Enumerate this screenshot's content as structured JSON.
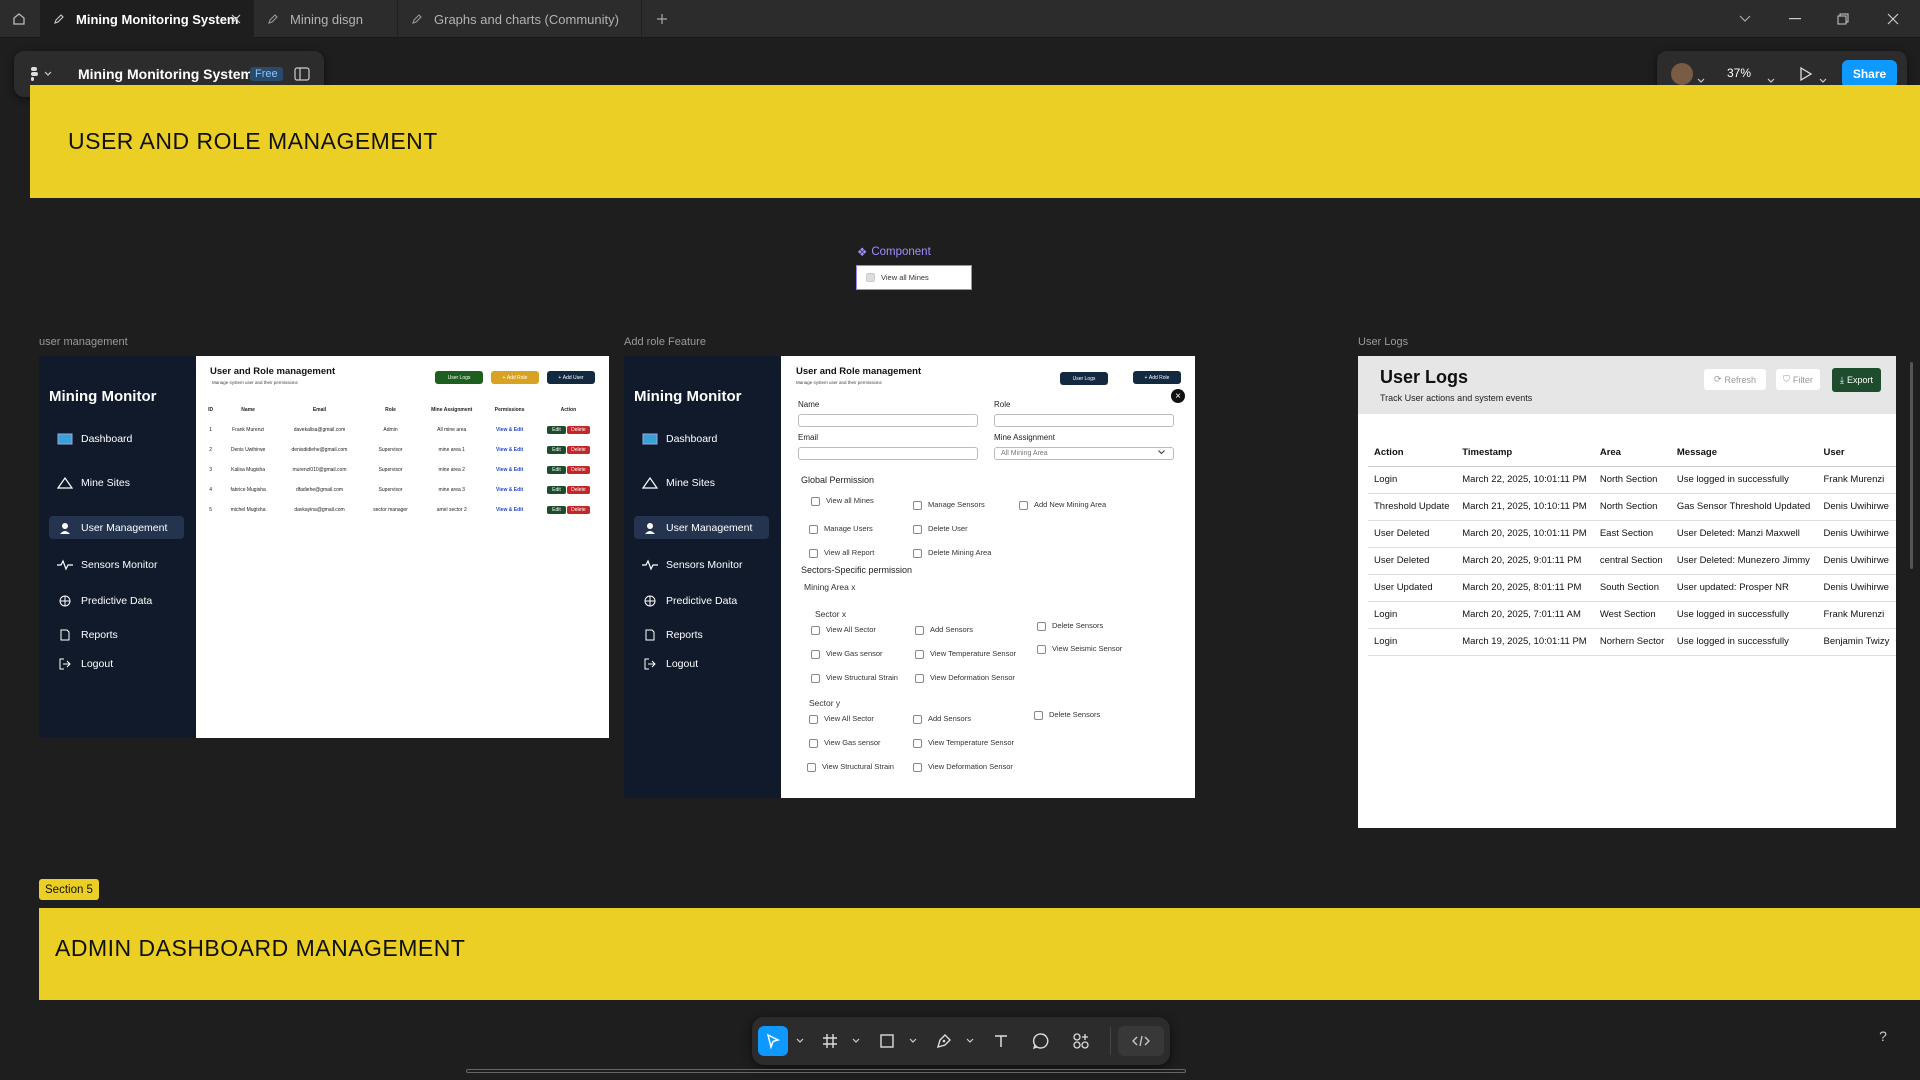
{
  "tabs": [
    {
      "label": "Mining Monitoring System",
      "active": true
    },
    {
      "label": "Mining disgn",
      "active": false
    },
    {
      "label": "Graphs and charts (Community)",
      "active": false
    }
  ],
  "file": {
    "title": "Mining Monitoring System",
    "plan": "Free"
  },
  "zoom": "37%",
  "share_label": "Share",
  "sections": {
    "top_title": "USER AND ROLE MANAGEMENT",
    "section_badge": "Section 5",
    "bottom_title": "ADMIN DASHBOARD MANAGEMENT"
  },
  "component": {
    "label": "Component",
    "item": "View all Mines"
  },
  "frame_labels": {
    "user_management": "user management",
    "add_role": "Add role Feature",
    "user_logs": "User Logs"
  },
  "sidebar": {
    "brand": "Mining  Monitor",
    "items": [
      "Dashboard",
      "Mine Sites",
      "User Management",
      "Sensors Monitor",
      "Predictive Data",
      "Reports",
      "Logout"
    ]
  },
  "user_mgmt": {
    "title": "User and Role management",
    "subtitle": "Manage system user and their permissions",
    "btn_logs": "User Logs",
    "btn_role": "Add Role",
    "btn_user": "Add User",
    "columns": [
      "ID",
      "Name",
      "Email",
      "Role",
      "Mine Assignment",
      "Permissions",
      "Action"
    ],
    "rows": [
      [
        "1",
        "Frank Murenzi",
        "davekalisa@gmail.com",
        "Admin",
        "All mine area",
        "View & Edit"
      ],
      [
        "2",
        "Denis Uwihirwe",
        "denisdidiehe@gmail.com",
        "Supervisor",
        "mine area 1",
        "View & Edit"
      ],
      [
        "3",
        "Kalisa Mugisha",
        "murenzi010@gmail.com",
        "Supervisor",
        "mine area 2",
        "View & Edit"
      ],
      [
        "4",
        "fabrice Mugisha",
        "dfadiehe@gmail.com",
        "Supervisor",
        "mine area 3",
        "View & Edit"
      ],
      [
        "5",
        "michel Mugisha",
        "davkayina@gmail.com",
        "sector manager",
        "amel sector 2",
        "View & Edit"
      ]
    ],
    "edit": "Edit",
    "delete": "Delete"
  },
  "add_role": {
    "title": "User and Role management",
    "subtitle": "Manage system user and their permissions",
    "btn_logs": "User Logs",
    "btn_role": "Add Role",
    "name_label": "Name",
    "role_label": "Role",
    "email_label": "Email",
    "mine_label": "Mine Assignment",
    "mine_value": "All Mining Area",
    "global_title": "Global Permission",
    "global_perms": [
      "View all Mines",
      "Manage Sensors",
      "Add New  Mining Area",
      "Manage Users",
      "Delete User",
      "View all Report",
      "Delete Mining Area"
    ],
    "sector_title": "Sectors-Specific permission",
    "mining_area": "Mining Area x",
    "sector_x": "Sector x",
    "sector_x_perms": [
      "View All Sector",
      "Add  Sensors",
      "Delete Sensors",
      "View Gas sensor",
      "View Temperature Sensor",
      "View Seismic Sensor",
      "View Structural Strain",
      "View Deformation Sensor"
    ],
    "sector_y": "Sector y",
    "sector_y_perms": [
      "View All Sector",
      "Add  Sensors",
      "Delete Sensors",
      "View Gas sensor",
      "View Temperature Sensor",
      "View Structural Strain",
      "View Deformation Sensor"
    ]
  },
  "logs": {
    "title": "User Logs",
    "subtitle": "Track User actions and system events",
    "refresh": "Refresh",
    "filter": "Filter",
    "export": "Export",
    "columns": [
      "Action",
      "Timestamp",
      "Area",
      "Message",
      "User"
    ],
    "rows": [
      [
        "Login",
        "March 22, 2025, 10:01:11 PM",
        "North Section",
        "Use logged in successfully",
        "Frank Murenzi"
      ],
      [
        "Threshold Update",
        "March 21, 2025, 10:10:11 PM",
        "North Section",
        "Gas Sensor Threshold Updated",
        "Denis Uwihirwe"
      ],
      [
        "User Deleted",
        "March 20, 2025, 10:01:11 PM",
        "East Section",
        "User Deleted: Manzi Maxwell",
        "Denis Uwihirwe"
      ],
      [
        "User Deleted",
        "March 20, 2025, 9:01:11 PM",
        "central Section",
        "User Deleted: Munezero Jimmy",
        "Denis Uwihirwe"
      ],
      [
        "User Updated",
        "March 20, 2025, 8:01:11 PM",
        "South Section",
        "User updated: Prosper NR",
        "Denis Uwihirwe"
      ],
      [
        "Login",
        "March 20, 2025, 7:01:11 AM",
        "West Section",
        "Use logged in successfully",
        "Frank Murenzi"
      ],
      [
        "Login",
        "March 19, 2025, 10:01:11 PM",
        "Norhern Sector",
        "Use logged in successfully",
        "Benjamin Twizy"
      ]
    ]
  },
  "colors": {
    "accent": "#0d99ff",
    "band": "#eccf25",
    "sidebar": "#111a2b",
    "dark_green": "#1d4d2c",
    "delete_red": "#c42727"
  }
}
